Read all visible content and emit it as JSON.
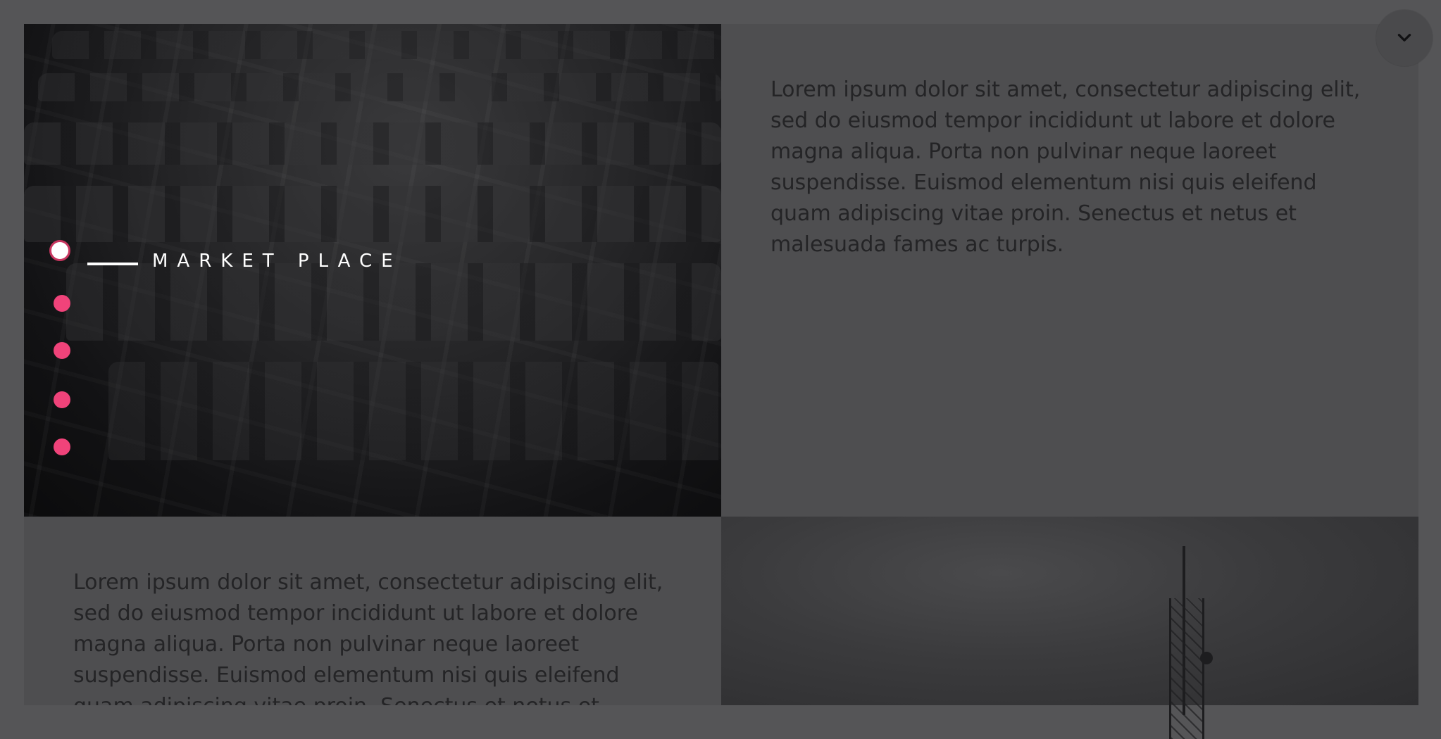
{
  "nav": {
    "active_label": "MARKET PLACE",
    "dot_count": 5,
    "accent_color": "#f0437a"
  },
  "sections": {
    "section1": {
      "paragraph": "Lorem ipsum dolor sit amet, consectetur adipiscing elit, sed do eiusmod tempor incididunt ut labore et dolore magna aliqua. Porta non pulvinar neque laoreet suspendisse. Euismod elementum nisi quis eleifend quam adipiscing vitae proin. Senectus et netus et malesuada fames ac turpis."
    },
    "section2": {
      "paragraph": "Lorem ipsum dolor sit amet, consectetur adipiscing elit, sed do eiusmod tempor incididunt ut labore et dolore magna aliqua. Porta non pulvinar neque laoreet suspendisse. Euismod elementum nisi quis eleifend quam adipiscing vitae proin. Senectus et netus et malesuada"
    }
  },
  "icons": {
    "scroll_button": "chevron-down-icon",
    "nav_active": "circle-icon"
  }
}
